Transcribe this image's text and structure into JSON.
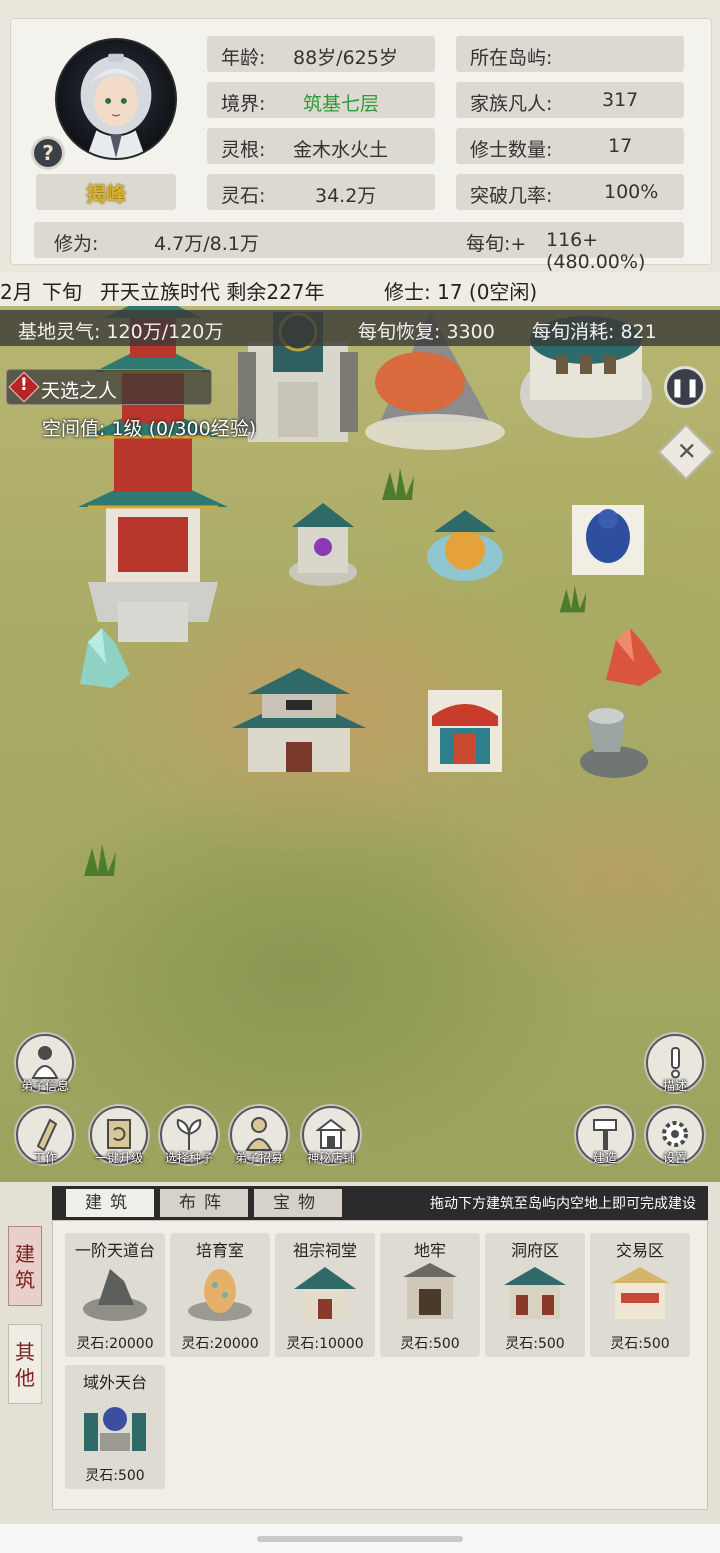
{
  "player": {
    "name": "揭峰",
    "help_icon": "?",
    "age_label": "年龄:",
    "age_value": "88岁/625岁",
    "realm_label": "境界:",
    "realm_value": "筑基七层",
    "root_label": "灵根:",
    "root_value": "金木水火土",
    "stone_label": "灵石:",
    "stone_value": "34.2万",
    "island_label": "所在岛屿:",
    "island_value": "",
    "mortals_label": "家族凡人:",
    "mortals_value": "317",
    "cultivators_label": "修士数量:",
    "cultivators_value": "17",
    "breakthrough_label": "突破几率:",
    "breakthrough_value": "100%",
    "cultivation_label": "修为:",
    "cultivation_value": "4.7万/8.1万",
    "per_turn_label": "每旬:+",
    "per_turn_value": "116+(480.00%)"
  },
  "timeline": {
    "month": "2月",
    "period": "下旬",
    "era": "开天立族时代 剩余227年",
    "cultivators": "修士: 17 (0空闲)"
  },
  "qi": {
    "base": "基地灵气: 120万/120万",
    "recovery": "每旬恢复: 3300",
    "consumption": "每旬消耗: 821"
  },
  "quest": {
    "title": "天选之人",
    "space_value": "空间值: 1级 (0/300经验)"
  },
  "actions_left": [
    {
      "label": "弟子信息",
      "icon": "disciple-icon"
    },
    {
      "label": "工作",
      "icon": "work-icon"
    },
    {
      "label": "一键升级",
      "icon": "upgrade-icon"
    },
    {
      "label": "选择种子",
      "icon": "seed-icon"
    },
    {
      "label": "弟子招募",
      "icon": "recruit-icon"
    },
    {
      "label": "神秘店铺",
      "icon": "shop-icon"
    }
  ],
  "actions_right": [
    {
      "label": "描述",
      "icon": "exclamation-icon"
    },
    {
      "label": "建造",
      "icon": "hammer-icon"
    },
    {
      "label": "设置",
      "icon": "gear-icon"
    }
  ],
  "build_panel": {
    "side_tabs": [
      "建筑",
      "其他"
    ],
    "tabs": [
      "建筑",
      "布阵",
      "宝物"
    ],
    "hint": "拖动下方建筑至岛屿内空地上即可完成建设",
    "cards": [
      {
        "name": "一阶天道台",
        "cost": "灵石:20000"
      },
      {
        "name": "培育室",
        "cost": "灵石:20000"
      },
      {
        "name": "祖宗祠堂",
        "cost": "灵石:10000"
      },
      {
        "name": "地牢",
        "cost": "灵石:500"
      },
      {
        "name": "洞府区",
        "cost": "灵石:500"
      },
      {
        "name": "交易区",
        "cost": "灵石:500"
      },
      {
        "name": "域外天台",
        "cost": "灵石:500"
      }
    ]
  },
  "colors": {
    "realm_green": "#2f9a3a",
    "name_gold": "#d8b233",
    "warning_red": "#b52525"
  }
}
